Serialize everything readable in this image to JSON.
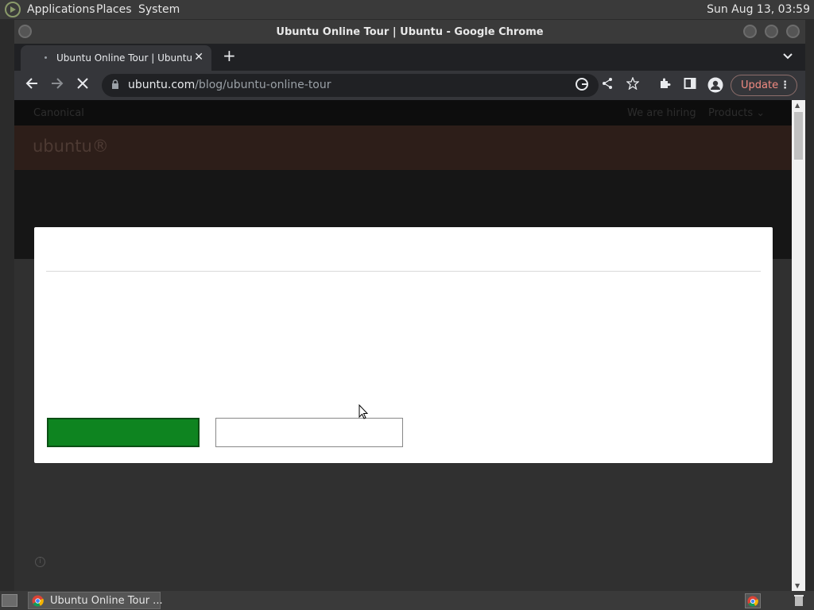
{
  "system_panel": {
    "menus": [
      "Applications",
      "Places",
      "System"
    ],
    "clock": "Sun Aug 13, 03:59"
  },
  "window": {
    "title": "Ubuntu Online Tour | Ubuntu - Google Chrome"
  },
  "browser": {
    "tab": {
      "title": "Ubuntu Online Tour | Ubuntu",
      "close": "✕"
    },
    "new_tab": "+",
    "tab_search": "⌄",
    "address": {
      "domain": "ubuntu.com",
      "path": "/blog/ubuntu-online-tour"
    },
    "update_label": "Update",
    "menu_dots": "⋮"
  },
  "page": {
    "canonical": "Canonical",
    "hiring": "We are hiring",
    "products": "Products ⌄",
    "logo": "ubuntu®"
  },
  "taskbar": {
    "task_label": "Ubuntu Online Tour ..."
  },
  "colors": {
    "modal_primary": "#0e8420",
    "ubuntu_bar": "#2d1e19"
  }
}
